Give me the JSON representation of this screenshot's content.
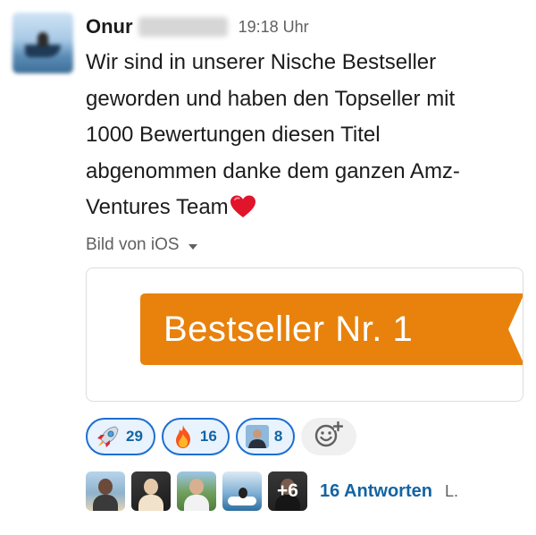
{
  "message": {
    "author": "Onur",
    "timestamp": "19:18 Uhr",
    "text_lines": [
      "Wir sind in unserer Nische Bestseller",
      "geworden und haben den Topseller mit",
      "1000 Bewertungen diesen Titel",
      "abgenommen danke dem ganzen Amz-",
      "Ventures Team"
    ],
    "emoji": "red-heart",
    "attachment_label": "Bild von iOS",
    "image_text": "Bestseller Nr. 1"
  },
  "reactions": [
    {
      "emoji": "rocket",
      "count": "29"
    },
    {
      "emoji": "fire",
      "count": "16"
    },
    {
      "emoji": "person-avatar",
      "count": "8"
    }
  ],
  "replies": {
    "more_count": "+6",
    "count_label": "16 Antworten",
    "trail": "L."
  },
  "colors": {
    "accent": "#1264a3",
    "reaction_border": "#1d6ed1",
    "reaction_bg": "#e8f3fd",
    "ribbon": "#e8820c"
  }
}
